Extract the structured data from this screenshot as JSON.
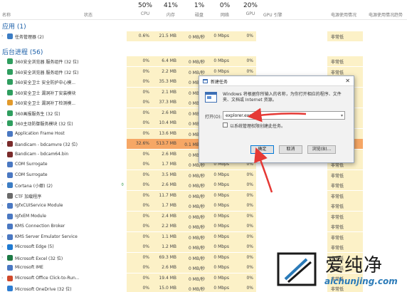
{
  "header": {
    "name": "名称",
    "status": "状态",
    "cpu_pct": "50%",
    "cpu": "CPU",
    "mem_pct": "41%",
    "mem": "内存",
    "disk_pct": "1%",
    "disk": "磁盘",
    "net_pct": "0%",
    "net": "网络",
    "gpu_pct": "20%",
    "gpu": "GPU",
    "gpu_engine": "GPU 引擎",
    "power": "电源使用情况",
    "power_trend": "电源使用情况趋势"
  },
  "sections": {
    "apps": "应用 (1)",
    "background": "后台进程 (56)"
  },
  "apps_rows": [
    {
      "name": "任务管理器 (2)",
      "cpu": "0.6%",
      "mem": "21.5 MB",
      "disk": "0 MB/秒",
      "net": "0 Mbps",
      "gpu": "0%",
      "power": "非常低",
      "icon": "taskmgr-icon",
      "color": "#3c7dc4",
      "expand": true
    }
  ],
  "bg_rows": [
    {
      "name": "360安全浏览器 服务组件 (32 位)",
      "cpu": "0%",
      "mem": "6.4 MB",
      "disk": "0 MB/秒",
      "net": "0 Mbps",
      "gpu": "0%",
      "power": "非常低",
      "icon": "360-icon",
      "color": "#2f9e5f"
    },
    {
      "name": "360安全浏览器 服务组件 (32 位)",
      "cpu": "0%",
      "mem": "2.2 MB",
      "disk": "0 MB/秒",
      "net": "0 Mbps",
      "gpu": "0%",
      "power": "非常低",
      "icon": "360-icon",
      "color": "#2f9e5f"
    },
    {
      "name": "360安全卫士 安全防护中心模...",
      "cpu": "0%",
      "mem": "35.3 MB",
      "disk": "0 MB/秒",
      "net": "0 Mbps",
      "gpu": "0%",
      "power": "非常低",
      "icon": "360-icon",
      "color": "#2f9e5f"
    },
    {
      "name": "360安全卫士 漏洞补丁安装模块",
      "cpu": "0%",
      "mem": "2.1 MB",
      "disk": "0 MB/秒",
      "net": "0 Mbps",
      "gpu": "0%",
      "power": "非常低",
      "icon": "360-icon",
      "color": "#2f9e5f"
    },
    {
      "name": "360安全卫士 漏洞补丁检测模...",
      "cpu": "0%",
      "mem": "37.3 MB",
      "disk": "0 MB/秒",
      "net": "0 Mbps",
      "gpu": "0%",
      "power": "非常低",
      "icon": "360-icon",
      "color": "#e29a2c"
    },
    {
      "name": "360画报服务生 (32 位)",
      "cpu": "0%",
      "mem": "2.6 MB",
      "disk": "0 MB/秒",
      "net": "0 Mbps",
      "gpu": "0%",
      "power": "非常低",
      "icon": "360-icon",
      "color": "#2f9e5f"
    },
    {
      "name": "360主动防御服务模块 (32 位)",
      "cpu": "0%",
      "mem": "10.4 MB",
      "disk": "0 MB/秒",
      "net": "0 Mbps",
      "gpu": "0%",
      "power": "非常低",
      "icon": "360-icon",
      "color": "#2f9e5f",
      "expand": true
    },
    {
      "name": "Application Frame Host",
      "cpu": "0%",
      "mem": "13.6 MB",
      "disk": "0 MB/秒",
      "net": "0 Mbps",
      "gpu": "0%",
      "power": "非常低",
      "icon": "app-frame-icon",
      "color": "#4a78c2"
    },
    {
      "name": "Bandicam - bdcamvre (32 位)",
      "cpu": "32.6%",
      "mem": "513.7 MB",
      "disk": "0.1 MB/秒",
      "net": "0 Mbps",
      "gpu": "0%",
      "power": "非常高",
      "icon": "bandicam-icon",
      "color": "#7a2b2b",
      "expand": true,
      "hot": true
    },
    {
      "name": "Bandicam - bdcam64.bin",
      "cpu": "0%",
      "mem": "2.6 MB",
      "disk": "0 MB/秒",
      "net": "0 Mbps",
      "gpu": "0%",
      "power": "非常低",
      "icon": "bandicam-icon",
      "color": "#7a2b2b"
    },
    {
      "name": "COM Surrogate",
      "cpu": "0%",
      "mem": "1.7 MB",
      "disk": "0 MB/秒",
      "net": "0 Mbps",
      "gpu": "0%",
      "power": "非常低",
      "icon": "com-icon",
      "color": "#4a78c2"
    },
    {
      "name": "COM Surrogate",
      "cpu": "0%",
      "mem": "3.5 MB",
      "disk": "0 MB/秒",
      "net": "0 Mbps",
      "gpu": "0%",
      "power": "非常低",
      "icon": "com-icon",
      "color": "#4a78c2"
    },
    {
      "name": "Cortana (小娜) (2)",
      "cpu": "0%",
      "mem": "2.6 MB",
      "disk": "0 MB/秒",
      "net": "0 Mbps",
      "gpu": "0%",
      "power": "非常低",
      "icon": "cortana-icon",
      "color": "#3c7dc4",
      "expand": true,
      "leaf": true
    },
    {
      "name": "CTF 加载程序",
      "cpu": "0%",
      "mem": "11.7 MB",
      "disk": "0 MB/秒",
      "net": "0 Mbps",
      "gpu": "0%",
      "power": "非常低",
      "icon": "ctf-icon",
      "color": "#6a6a6a"
    },
    {
      "name": "IgfxCUIService Module",
      "cpu": "0%",
      "mem": "1.7 MB",
      "disk": "0 MB/秒",
      "net": "0 Mbps",
      "gpu": "0%",
      "power": "非常低",
      "icon": "intel-icon",
      "color": "#4a78c2",
      "expand": true
    },
    {
      "name": "IgfxEM Module",
      "cpu": "0%",
      "mem": "2.4 MB",
      "disk": "0 MB/秒",
      "net": "0 Mbps",
      "gpu": "0%",
      "power": "非常低",
      "icon": "intel-icon",
      "color": "#4a78c2"
    },
    {
      "name": "KMS Connection Broker",
      "cpu": "0%",
      "mem": "2.2 MB",
      "disk": "0 MB/秒",
      "net": "0 Mbps",
      "gpu": "0%",
      "power": "非常低",
      "icon": "kms-icon",
      "color": "#4a78c2"
    },
    {
      "name": "KMS Server Emulator Service",
      "cpu": "0%",
      "mem": "1.1 MB",
      "disk": "0 MB/秒",
      "net": "0 Mbps",
      "gpu": "0%",
      "power": "非常低",
      "icon": "kms-icon",
      "color": "#4a78c2",
      "expand": true
    },
    {
      "name": "Microsoft Edge (5)",
      "cpu": "0%",
      "mem": "1.2 MB",
      "disk": "0 MB/秒",
      "net": "0 Mbps",
      "gpu": "0%",
      "power": "非常低",
      "icon": "edge-icon",
      "color": "#1f7ad1",
      "expand": true
    },
    {
      "name": "Microsoft Excel (32 位)",
      "cpu": "0%",
      "mem": "69.3 MB",
      "disk": "0 MB/秒",
      "net": "0 Mbps",
      "gpu": "0%",
      "power": "非常低",
      "icon": "excel-icon",
      "color": "#1d7a45",
      "expand": true
    },
    {
      "name": "Microsoft IME",
      "cpu": "0%",
      "mem": "2.6 MB",
      "disk": "0 MB/秒",
      "net": "0 Mbps",
      "gpu": "0%",
      "power": "非常低",
      "icon": "ime-icon",
      "color": "#4a78c2"
    },
    {
      "name": "Microsoft Office Click-to-Run...",
      "cpu": "0%",
      "mem": "19.4 MB",
      "disk": "0 MB/秒",
      "net": "0 Mbps",
      "gpu": "0%",
      "power": "非常低",
      "icon": "office-icon",
      "color": "#d0492b",
      "expand": true
    },
    {
      "name": "Microsoft OneDrive (32 位)",
      "cpu": "0%",
      "mem": "15.0 MB",
      "disk": "0 MB/秒",
      "net": "0 Mbps",
      "gpu": "0%",
      "power": "非常低",
      "icon": "onedrive-icon",
      "color": "#2e7dd1"
    }
  ],
  "dialog": {
    "title": "新建任务",
    "description": "Windows 将根据你所输入的名称，为你打开相应的程序、文件夹、文档或 Internet 资源。",
    "open_label": "打开(O):",
    "command_value": "explorer.exe",
    "admin_checkbox": "以系统管理权限创建此任务。",
    "ok": "确定",
    "cancel": "取消",
    "browse": "浏览(B)...",
    "close_glyph": "✕"
  },
  "watermark": {
    "brand": "爱纯净",
    "url": "aichunjing.com"
  },
  "colors": {
    "accent": "#1b5fa8",
    "tint": "#fcf1c7",
    "hot": "#f6a765",
    "arrow": "#e53935"
  }
}
